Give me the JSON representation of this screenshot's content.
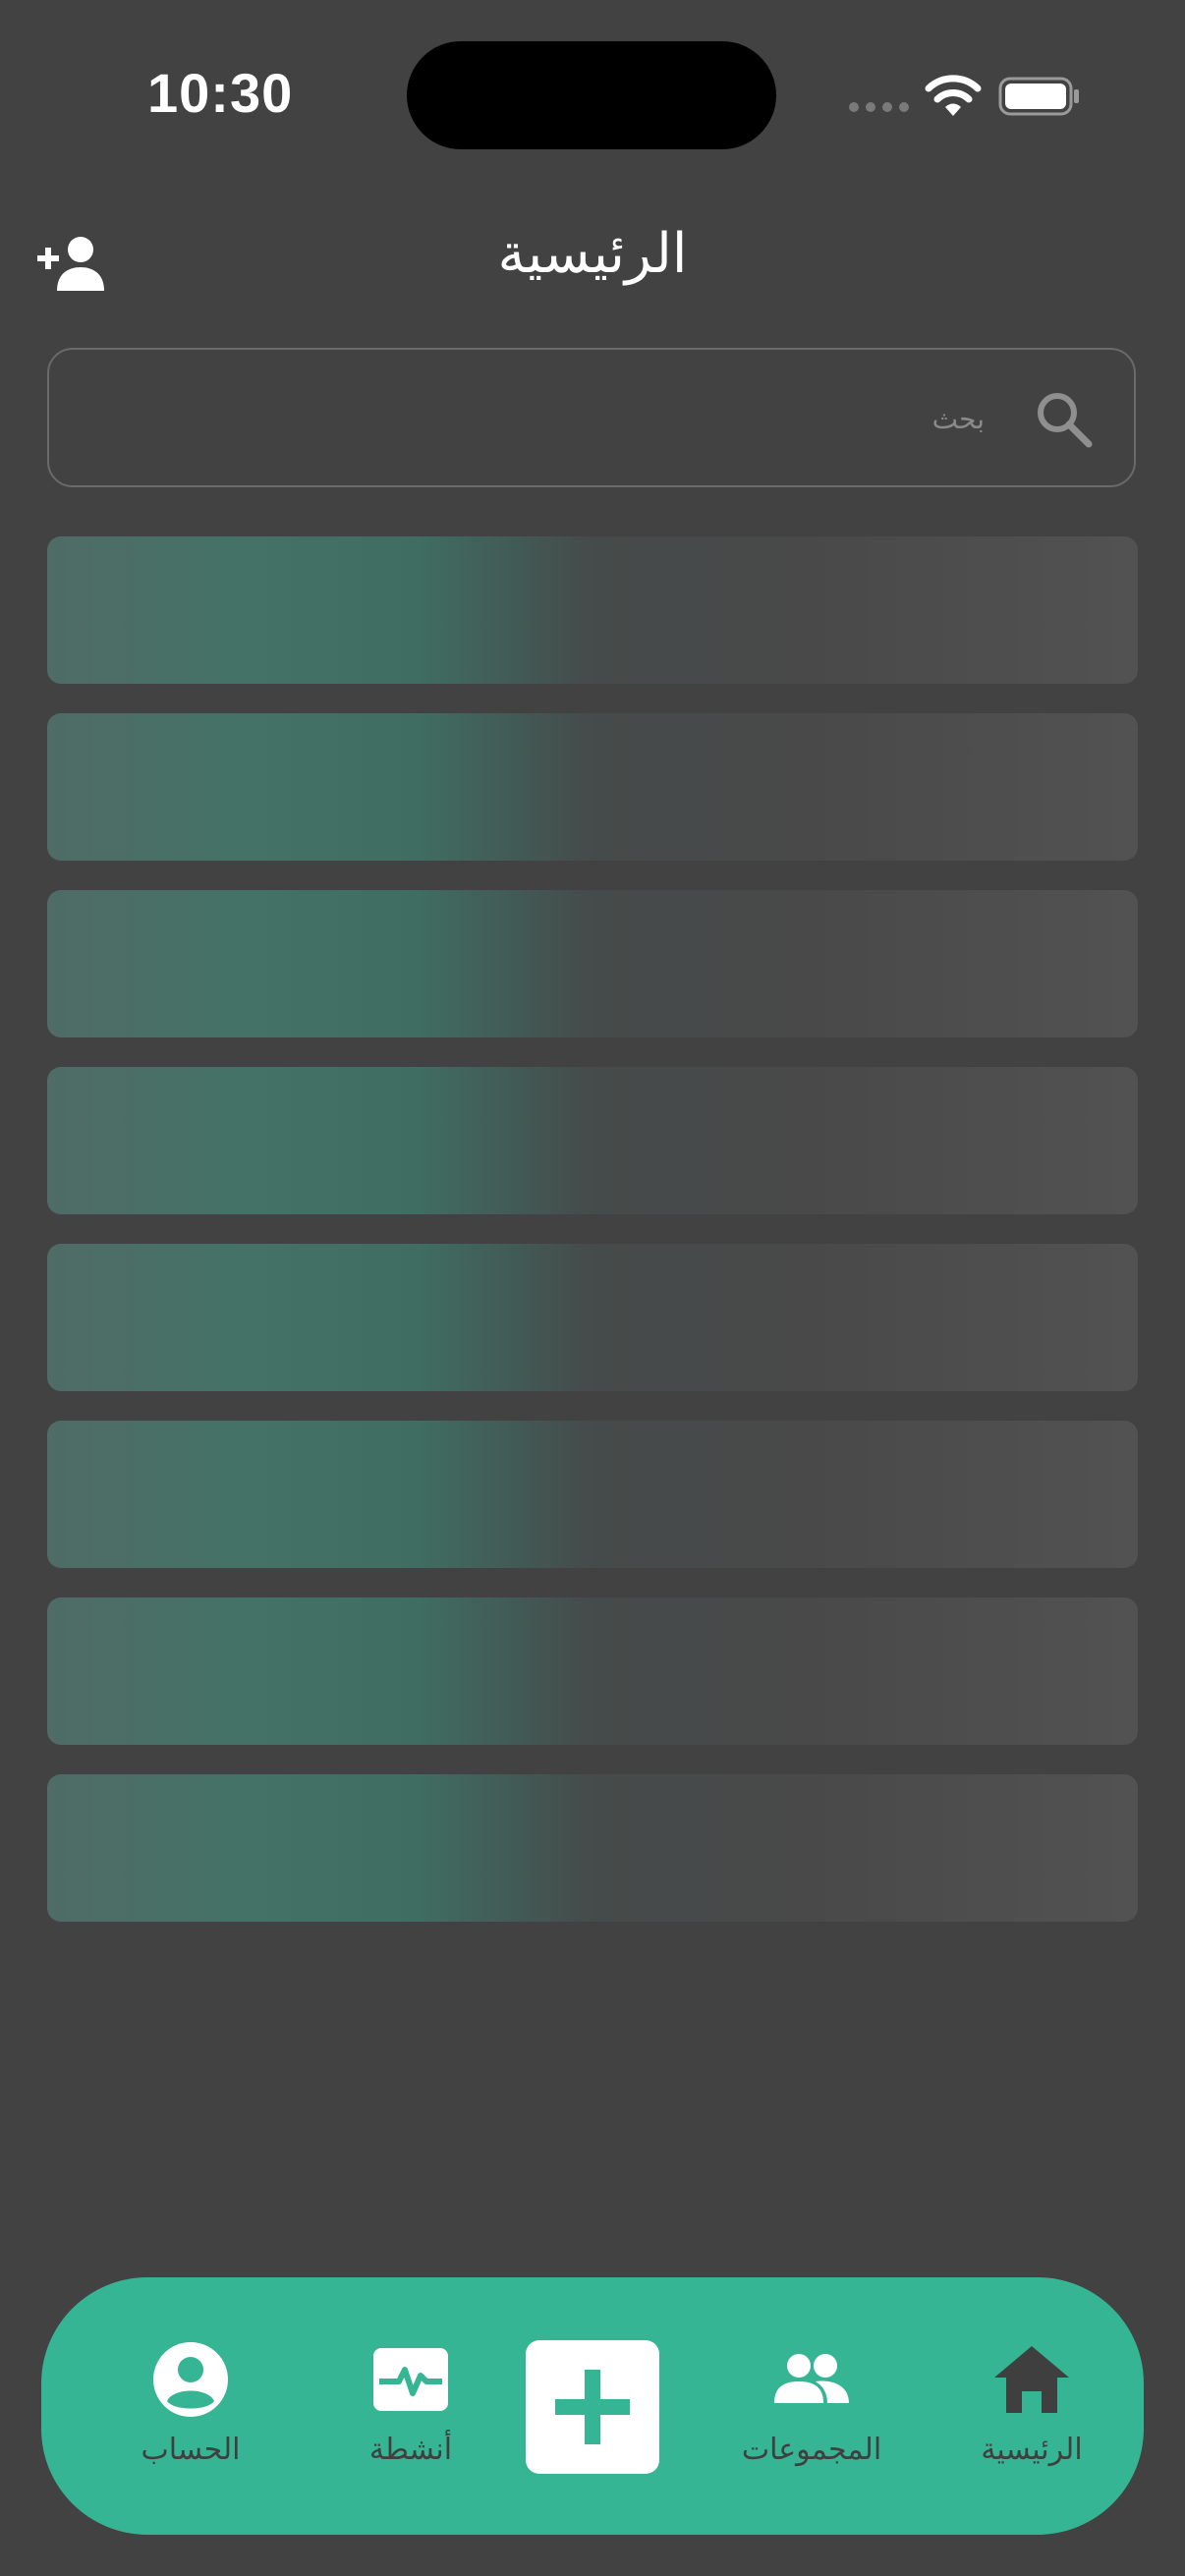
{
  "status_bar": {
    "time": "10:30"
  },
  "header": {
    "title": "الرئيسية"
  },
  "search": {
    "placeholder": "بحث",
    "value": ""
  },
  "list": {
    "placeholder_rows": 8
  },
  "bottom_nav": {
    "items": [
      {
        "label": "الحساب",
        "icon": "account-circle-icon"
      },
      {
        "label": "أنشطة",
        "icon": "activity-icon"
      },
      {
        "label": "",
        "icon": "add-icon"
      },
      {
        "label": "المجموعات",
        "icon": "groups-icon"
      },
      {
        "label": "الرئيسية",
        "icon": "home-icon"
      }
    ]
  },
  "colors": {
    "background": "#424242",
    "accent": "#35b594",
    "nav_icon": "#3f3f3f"
  }
}
